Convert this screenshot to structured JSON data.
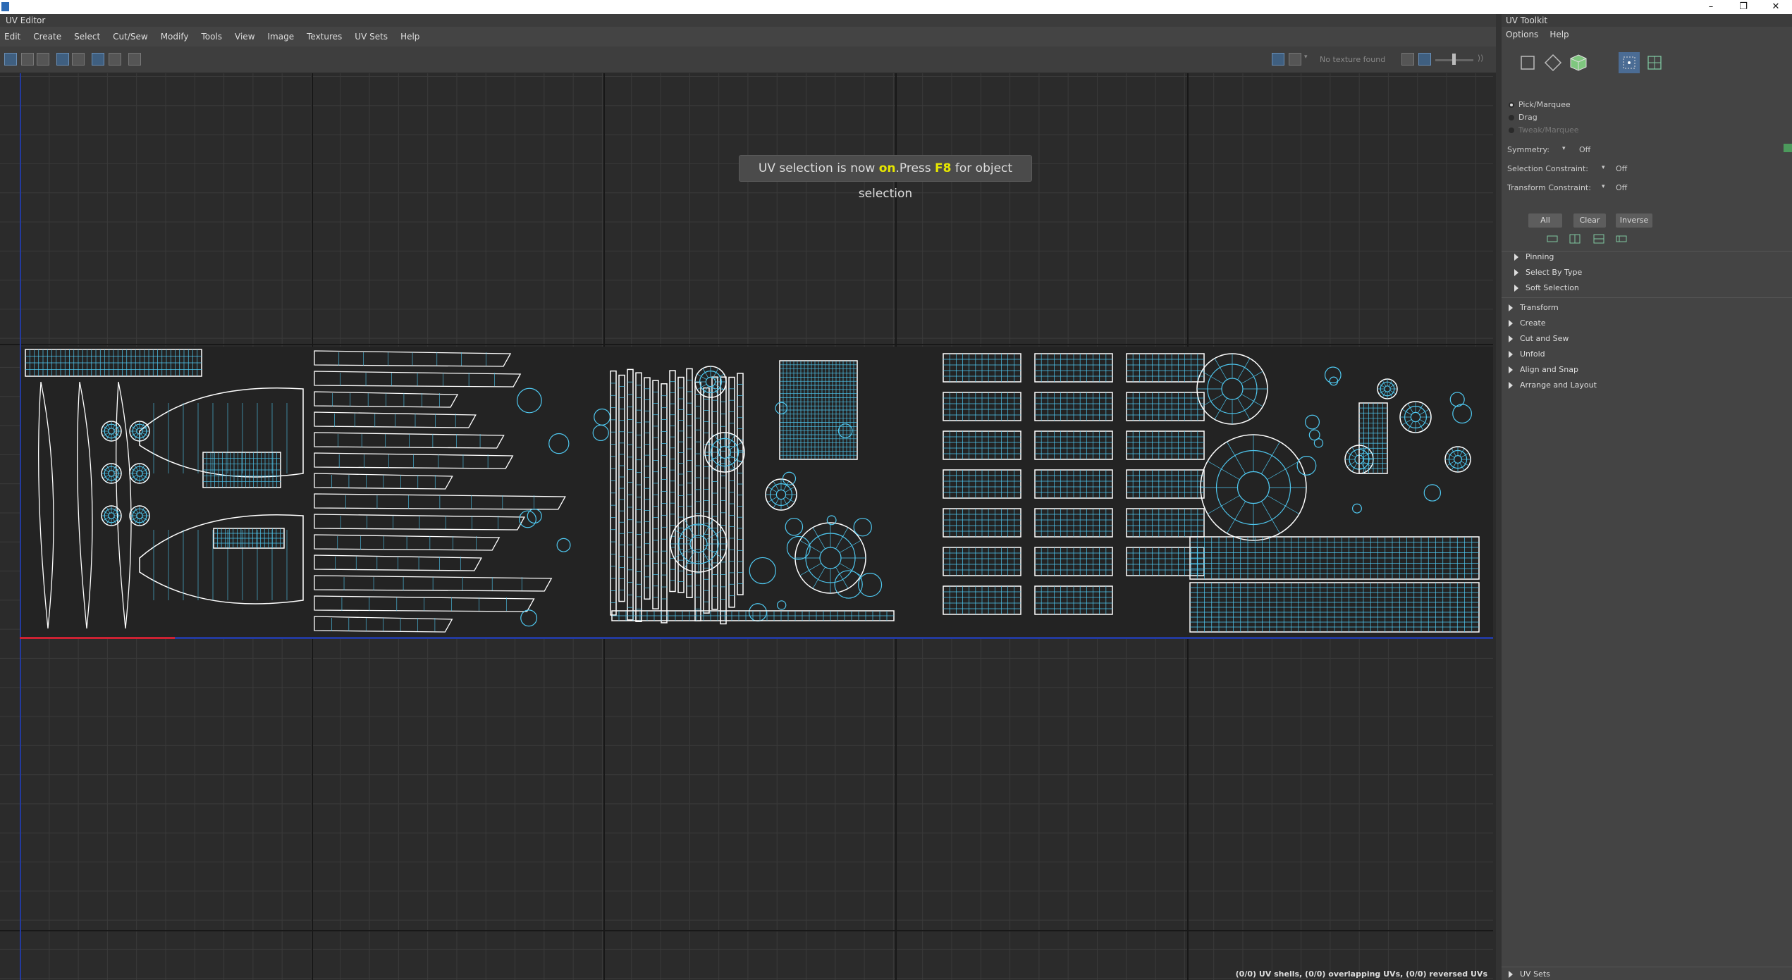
{
  "window": {
    "minimize": "–",
    "restore": "❐",
    "close": "✕"
  },
  "editor": {
    "title": "UV Editor",
    "menu": [
      "Edit",
      "Create",
      "Select",
      "Cut/Sew",
      "Modify",
      "Tools",
      "View",
      "Image",
      "Textures",
      "UV Sets",
      "Help"
    ],
    "texture_status": "No texture found",
    "notification": {
      "prefix": "UV selection is now ",
      "state": "on",
      "middle": ".Press ",
      "key": "F8",
      "suffix": " for object selection"
    },
    "status_line": "(0/0) UV shells, (0/0) overlapping UVs, (0/0) reversed UVs"
  },
  "toolkit": {
    "title": "UV Toolkit",
    "menu": [
      "Options",
      "Help"
    ],
    "modes": [
      {
        "label": "Pick/Marquee",
        "selected": true
      },
      {
        "label": "Drag",
        "selected": false
      },
      {
        "label": "Tweak/Marquee",
        "selected": false
      }
    ],
    "symmetry": {
      "label": "Symmetry:",
      "value": "Off"
    },
    "selection_constraint": {
      "label": "Selection Constraint:",
      "value": "Off"
    },
    "transform_constraint": {
      "label": "Transform Constraint:",
      "value": "Off"
    },
    "buttons": {
      "all": "All",
      "clear": "Clear",
      "inverse": "Inverse"
    },
    "sub_sections": [
      "Pinning",
      "Select By Type",
      "Soft Selection"
    ],
    "sections": [
      "Transform",
      "Create",
      "Cut and Sew",
      "Unfold",
      "Align and Snap",
      "Arrange and Layout"
    ],
    "uv_sets": "UV Sets"
  },
  "colors": {
    "uv_wire": "#4fc8f0",
    "uv_edge": "#ffffff",
    "highlight": "#e6e600",
    "viewport_bg": "#2b2b2b"
  }
}
